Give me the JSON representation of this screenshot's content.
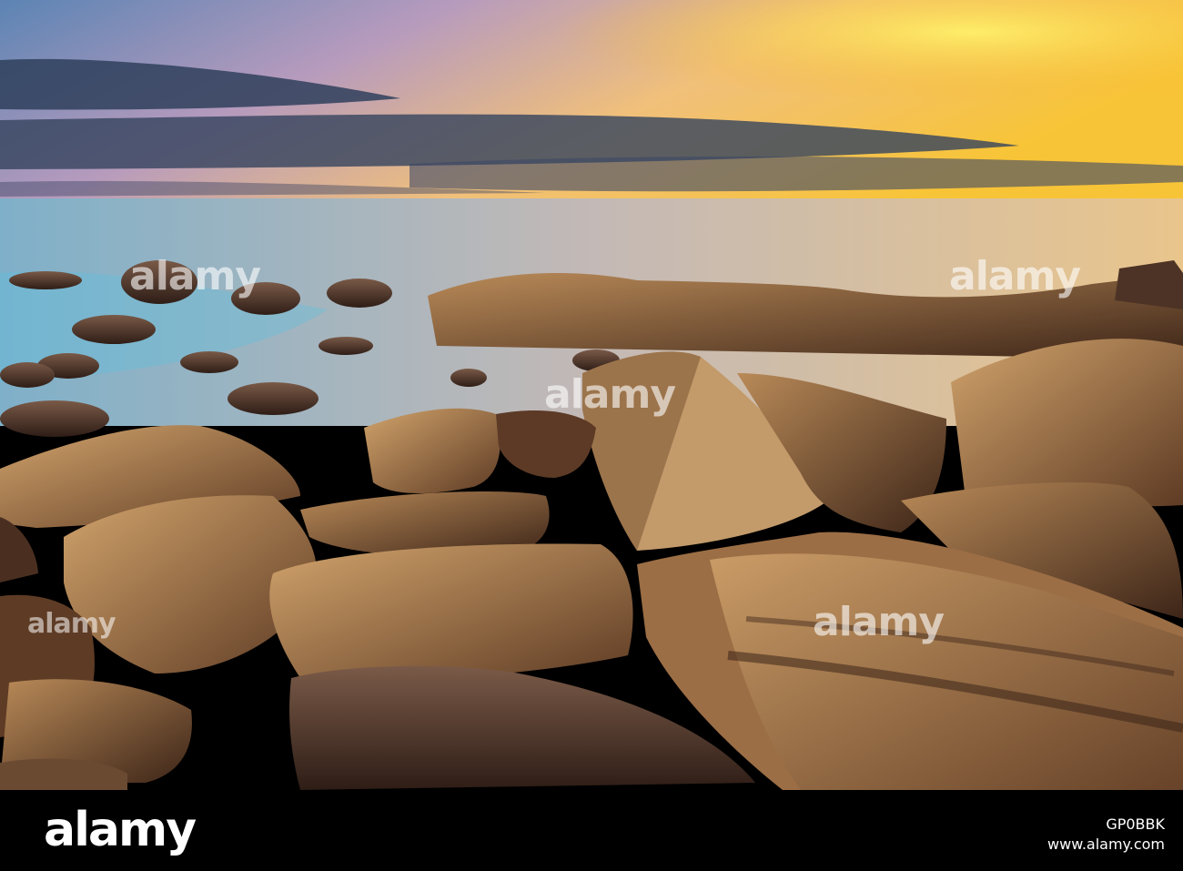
{
  "image": {
    "subject": "rocky coastline at sunset",
    "colors": {
      "sky_top": "#6d8fb0",
      "sky_glow": "#f5c23c",
      "sea": "#9fb8c6",
      "rock": "#8a5a36",
      "rock_light": "#c89a62"
    }
  },
  "watermark": {
    "text": "alamy"
  },
  "footer": {
    "logo": "alamy",
    "image_id": "GP0BBK",
    "url": "www.alamy.com"
  }
}
